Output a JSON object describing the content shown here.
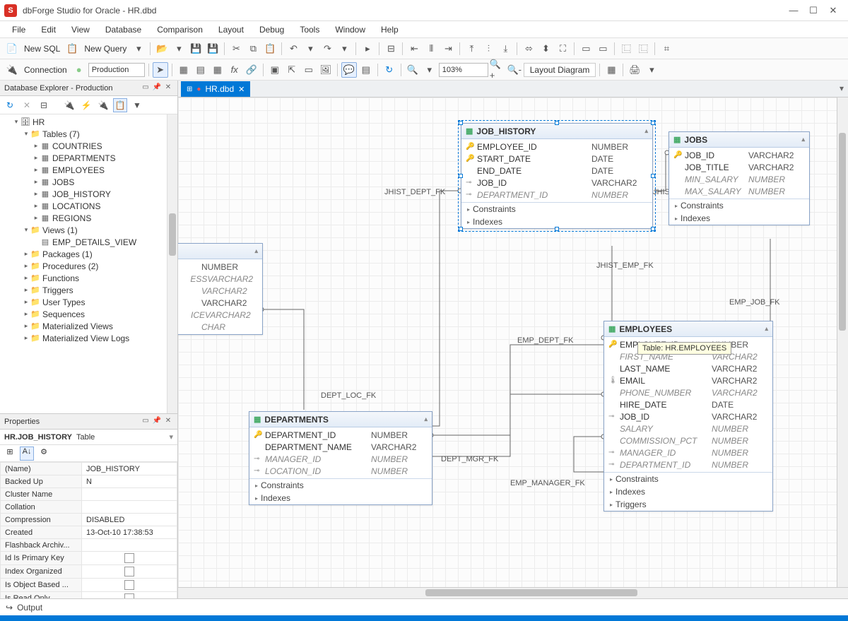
{
  "app": {
    "title": "dbForge Studio for Oracle - HR.dbd"
  },
  "menu": [
    "File",
    "Edit",
    "View",
    "Database",
    "Comparison",
    "Layout",
    "Debug",
    "Tools",
    "Window",
    "Help"
  ],
  "toolbar1": {
    "new_sql": "New SQL",
    "new_query": "New Query"
  },
  "toolbar2": {
    "conn_label": "Connection",
    "conn_value": "Production",
    "zoom": "103%",
    "layout_btn": "Layout Diagram"
  },
  "explorer": {
    "title": "Database Explorer - Production",
    "db": "HR",
    "tables_label": "Tables (7)",
    "tables": [
      "COUNTRIES",
      "DEPARTMENTS",
      "EMPLOYEES",
      "JOBS",
      "JOB_HISTORY",
      "LOCATIONS",
      "REGIONS"
    ],
    "views_label": "Views (1)",
    "views": [
      "EMP_DETAILS_VIEW"
    ],
    "folders": [
      "Packages (1)",
      "Procedures (2)",
      "Functions",
      "Triggers",
      "User Types",
      "Sequences",
      "Materialized Views",
      "Materialized View Logs"
    ]
  },
  "properties": {
    "title": "Properties",
    "obj": "HR.JOB_HISTORY",
    "obj_type": "Table",
    "rows": [
      {
        "k": "(Name)",
        "v": "JOB_HISTORY"
      },
      {
        "k": "Backed Up",
        "v": "N"
      },
      {
        "k": "Cluster Name",
        "v": ""
      },
      {
        "k": "Collation",
        "v": ""
      },
      {
        "k": "Compression",
        "v": "DISABLED"
      },
      {
        "k": "Created",
        "v": "13-Oct-10 17:38:53"
      },
      {
        "k": "Flashback Archiv...",
        "v": ""
      },
      {
        "k": "Id Is Primary Key",
        "v": "chk"
      },
      {
        "k": "Index Organized",
        "v": "chk"
      },
      {
        "k": "Is Object Based ...",
        "v": "chk"
      },
      {
        "k": "Is Read Only",
        "v": "chk"
      }
    ]
  },
  "tab": {
    "label": "HR.dbd"
  },
  "fk_labels": {
    "jhist_dept": "JHIST_DEPT_FK",
    "jhist_job": "JHIST_JOB_FK",
    "jhist_emp": "JHIST_EMP_FK",
    "emp_job": "EMP_JOB_FK",
    "emp_dept": "EMP_DEPT_FK",
    "dept_loc": "DEPT_LOC_FK",
    "dept_mgr": "DEPT_MGR_FK",
    "emp_manager": "EMP_MANAGER_FK"
  },
  "entities": {
    "job_history": {
      "name": "JOB_HISTORY",
      "cols": [
        {
          "ico": "pk",
          "n": "EMPLOYEE_ID",
          "t": "NUMBER"
        },
        {
          "ico": "pk",
          "n": "START_DATE",
          "t": "DATE"
        },
        {
          "ico": "",
          "n": "END_DATE",
          "t": "DATE"
        },
        {
          "ico": "fk",
          "n": "JOB_ID",
          "t": "VARCHAR2"
        },
        {
          "ico": "fk",
          "n": "DEPARTMENT_ID",
          "t": "NUMBER",
          "fk": true
        }
      ],
      "sec": [
        "Constraints",
        "Indexes"
      ]
    },
    "jobs": {
      "name": "JOBS",
      "cols": [
        {
          "ico": "pk",
          "n": "JOB_ID",
          "t": "VARCHAR2"
        },
        {
          "ico": "",
          "n": "JOB_TITLE",
          "t": "VARCHAR2"
        },
        {
          "ico": "",
          "n": "MIN_SALARY",
          "t": "NUMBER",
          "fk": true
        },
        {
          "ico": "",
          "n": "MAX_SALARY",
          "t": "NUMBER",
          "fk": true
        }
      ],
      "sec": [
        "Constraints",
        "Indexes"
      ]
    },
    "partial": {
      "name": "",
      "cols": [
        {
          "ico": "",
          "n": "",
          "t": "NUMBER"
        },
        {
          "ico": "",
          "n": "ESS",
          "t": "VARCHAR2",
          "fk": true
        },
        {
          "ico": "",
          "n": "",
          "t": "VARCHAR2",
          "fk": true
        },
        {
          "ico": "",
          "n": "",
          "t": "VARCHAR2"
        },
        {
          "ico": "",
          "n": "ICE",
          "t": "VARCHAR2",
          "fk": true
        },
        {
          "ico": "",
          "n": "",
          "t": "CHAR",
          "fk": true
        }
      ],
      "sec": []
    },
    "departments": {
      "name": "DEPARTMENTS",
      "cols": [
        {
          "ico": "pk",
          "n": "DEPARTMENT_ID",
          "t": "NUMBER"
        },
        {
          "ico": "",
          "n": "DEPARTMENT_NAME",
          "t": "VARCHAR2"
        },
        {
          "ico": "fk",
          "n": "MANAGER_ID",
          "t": "NUMBER",
          "fk": true
        },
        {
          "ico": "fk",
          "n": "LOCATION_ID",
          "t": "NUMBER",
          "fk": true
        }
      ],
      "sec": [
        "Constraints",
        "Indexes"
      ]
    },
    "employees": {
      "name": "EMPLOYEES",
      "cols": [
        {
          "ico": "pk",
          "n": "EMPLOYEE_ID",
          "t": "NUMBER"
        },
        {
          "ico": "",
          "n": "FIRST_NAME",
          "t": "VARCHAR2",
          "fk": true
        },
        {
          "ico": "",
          "n": "LAST_NAME",
          "t": "VARCHAR2"
        },
        {
          "ico": "uq",
          "n": "EMAIL",
          "t": "VARCHAR2"
        },
        {
          "ico": "",
          "n": "PHONE_NUMBER",
          "t": "VARCHAR2",
          "fk": true
        },
        {
          "ico": "",
          "n": "HIRE_DATE",
          "t": "DATE"
        },
        {
          "ico": "fk",
          "n": "JOB_ID",
          "t": "VARCHAR2"
        },
        {
          "ico": "",
          "n": "SALARY",
          "t": "NUMBER",
          "fk": true
        },
        {
          "ico": "",
          "n": "COMMISSION_PCT",
          "t": "NUMBER",
          "fk": true
        },
        {
          "ico": "fk",
          "n": "MANAGER_ID",
          "t": "NUMBER",
          "fk": true
        },
        {
          "ico": "fk",
          "n": "DEPARTMENT_ID",
          "t": "NUMBER",
          "fk": true
        }
      ],
      "sec": [
        "Constraints",
        "Indexes",
        "Triggers"
      ]
    }
  },
  "tooltip": "Table: HR.EMPLOYEES",
  "output": "Output"
}
